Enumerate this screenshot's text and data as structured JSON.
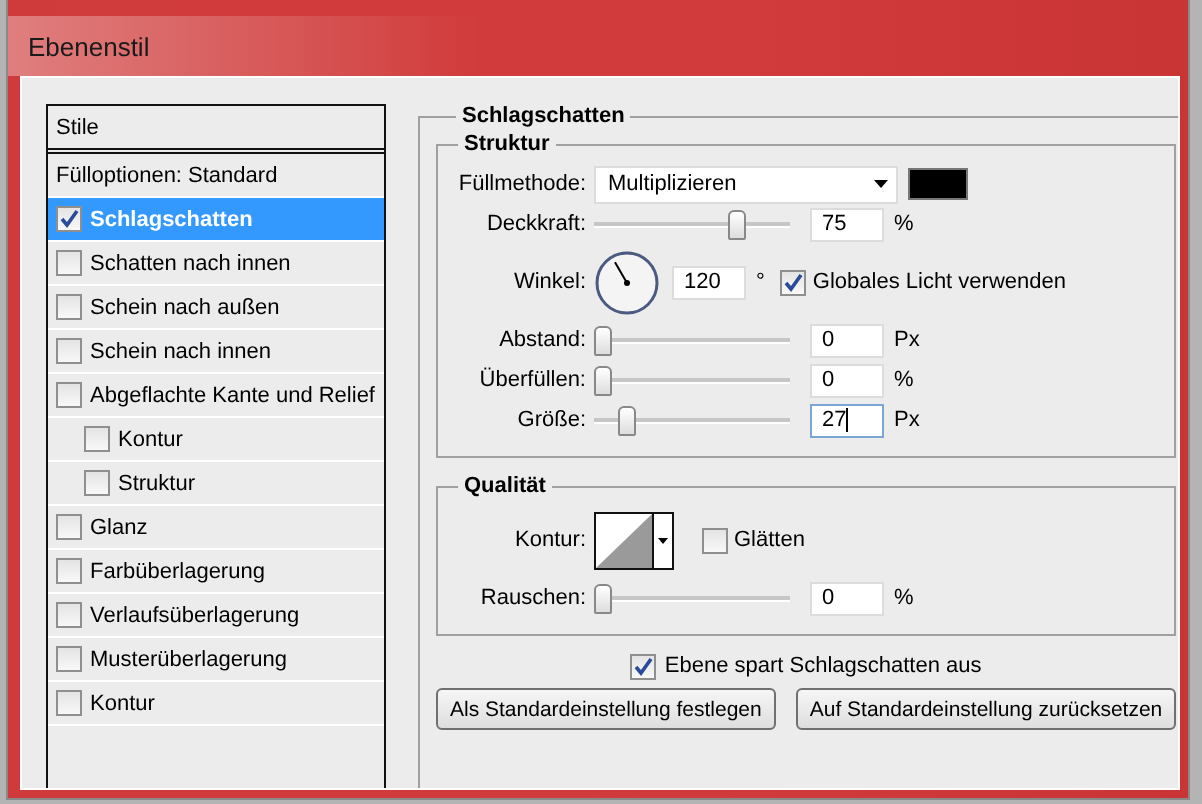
{
  "window": {
    "title": "Ebenenstil"
  },
  "styles_panel": {
    "header": "Stile",
    "items": [
      {
        "kind": "plain",
        "label": "Fülloptionen: Standard",
        "selected": false
      },
      {
        "kind": "check",
        "label": "Schlagschatten",
        "checked": true,
        "selected": true
      },
      {
        "kind": "check",
        "label": "Schatten nach innen",
        "checked": false,
        "selected": false
      },
      {
        "kind": "check",
        "label": "Schein nach außen",
        "checked": false,
        "selected": false
      },
      {
        "kind": "check",
        "label": "Schein nach innen",
        "checked": false,
        "selected": false
      },
      {
        "kind": "check",
        "label": "Abgeflachte Kante und Relief",
        "checked": false,
        "selected": false,
        "children": [
          {
            "kind": "check",
            "label": "Kontur",
            "checked": false,
            "selected": false
          },
          {
            "kind": "check",
            "label": "Struktur",
            "checked": false,
            "selected": false
          }
        ]
      },
      {
        "kind": "check",
        "label": "Glanz",
        "checked": false,
        "selected": false
      },
      {
        "kind": "check",
        "label": "Farbüberlagerung",
        "checked": false,
        "selected": false
      },
      {
        "kind": "check",
        "label": "Verlaufsüberlagerung",
        "checked": false,
        "selected": false
      },
      {
        "kind": "check",
        "label": "Musterüberlagerung",
        "checked": false,
        "selected": false
      },
      {
        "kind": "check",
        "label": "Kontur",
        "checked": false,
        "selected": false
      }
    ]
  },
  "effect": {
    "title": "Schlagschatten",
    "structure": {
      "title": "Struktur",
      "rows": [
        {
          "kind": "select",
          "label": "Füllmethode:",
          "value": "Multiplizieren",
          "color": "#000000"
        },
        {
          "kind": "slider",
          "label": "Deckkraft:",
          "level": 0.75,
          "value": "75",
          "unit": "%",
          "focused": false
        },
        {
          "kind": "angle",
          "label": "Winkel:",
          "value": "120",
          "unit": "°",
          "option": {
            "label": "Globales Licht verwenden",
            "checked": true
          }
        },
        {
          "kind": "slider",
          "label": "Abstand:",
          "level": 0,
          "value": "0",
          "unit": "Px",
          "focused": false
        },
        {
          "kind": "slider",
          "label": "Überfüllen:",
          "level": 0,
          "value": "0",
          "unit": "%",
          "focused": false
        },
        {
          "kind": "slider",
          "label": "Größe:",
          "level": 0.14,
          "value": "27",
          "unit": "Px",
          "focused": true
        }
      ]
    },
    "quality": {
      "title": "Qualität",
      "rows": [
        {
          "kind": "contour",
          "label": "Kontur:",
          "option": {
            "label": "Glätten",
            "checked": false
          }
        },
        {
          "kind": "slider",
          "label": "Rauschen:",
          "level": 0,
          "value": "0",
          "unit": "%",
          "focused": false
        }
      ]
    },
    "knockout": {
      "label": "Ebene spart Schlagschatten aus",
      "checked": true
    },
    "buttons": [
      "Als Standardeinstellung festlegen",
      "Auf Standardeinstellung zurücksetzen"
    ]
  }
}
